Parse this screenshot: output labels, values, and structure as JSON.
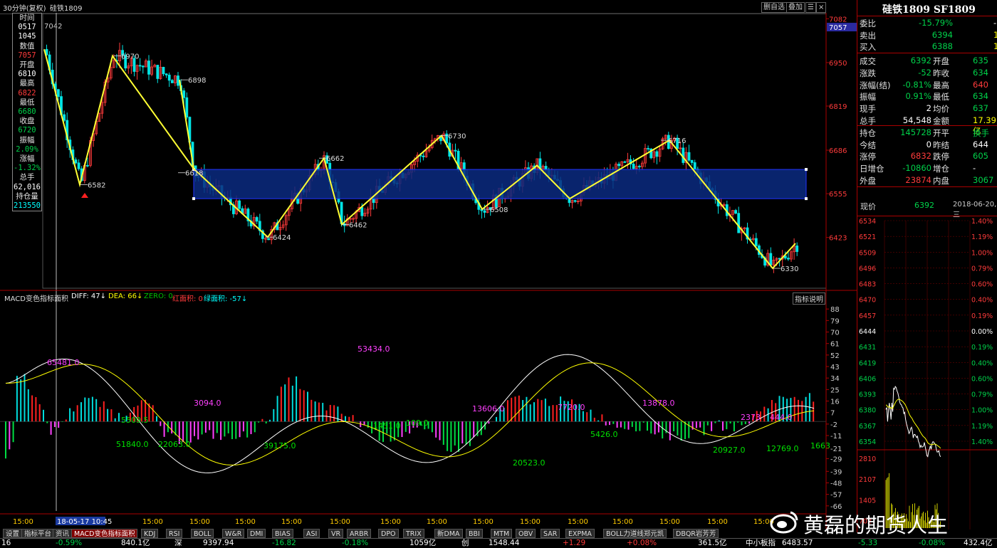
{
  "topbar": {
    "period": "30分钟(复权)",
    "symbol": "硅铁1809",
    "btn_fav": "删自选",
    "btn_overlay": "叠加",
    "btn_more": "☰",
    "btn_close": "×"
  },
  "infobox": [
    {
      "t": "时间",
      "c": "lbl"
    },
    {
      "t": "0517",
      "c": "white"
    },
    {
      "t": "1045",
      "c": "white"
    },
    {
      "t": "数值",
      "c": "lbl"
    },
    {
      "t": "7057",
      "c": "red"
    },
    {
      "t": "开盘",
      "c": "lbl"
    },
    {
      "t": "6810",
      "c": "white"
    },
    {
      "t": "最高",
      "c": "lbl"
    },
    {
      "t": "6822",
      "c": "red"
    },
    {
      "t": "最低",
      "c": "lbl"
    },
    {
      "t": "6680",
      "c": "green"
    },
    {
      "t": "收盘",
      "c": "lbl"
    },
    {
      "t": "6720",
      "c": "green"
    },
    {
      "t": "振幅",
      "c": "lbl"
    },
    {
      "t": "2.09%",
      "c": "green"
    },
    {
      "t": "涨幅",
      "c": "lbl"
    },
    {
      "t": "-1.32%",
      "c": "green"
    },
    {
      "t": "总手",
      "c": "lbl"
    },
    {
      "t": "62,016",
      "c": "white"
    },
    {
      "t": "持仓量",
      "c": "lbl"
    },
    {
      "t": "213550",
      "c": "cyan"
    }
  ],
  "price_axis": {
    "ticks": [
      "7082",
      "6950",
      "6819",
      "6686",
      "6555",
      "6423"
    ],
    "current": "7057",
    "corner_value": "7042"
  },
  "pivots": [
    {
      "label": "6970",
      "v": 6970
    },
    {
      "label": "6582",
      "v": 6582
    },
    {
      "label": "6898",
      "v": 6898
    },
    {
      "label": "6618",
      "v": 6618
    },
    {
      "label": "6424",
      "v": 6424
    },
    {
      "label": "6662",
      "v": 6662
    },
    {
      "label": "6462",
      "v": 6462
    },
    {
      "label": "6730",
      "v": 6730
    },
    {
      "label": "6508",
      "v": 6508
    },
    {
      "label": "6716",
      "v": 6716
    },
    {
      "label": "6330",
      "v": 6330
    }
  ],
  "macd_header": {
    "name": "MACD变色指标面积",
    "diff": "DIFF: 47↓",
    "dea": "DEA: 66↓",
    "zero": "ZERO: 0",
    "red_area": "红面积: 0",
    "green_area": "绿面积: -57↓",
    "help": "指标说明"
  },
  "macd_axis": [
    "88",
    "79",
    "70",
    "61",
    "52",
    "43",
    "34",
    "25",
    "16",
    "7",
    "-2",
    "-11",
    "-21",
    "-29",
    "-39",
    "-48",
    "-57",
    "-66"
  ],
  "macd_labels": [
    "65481.0",
    "5509.5",
    "51840.0",
    "22063.0",
    "3094.0",
    "39175.0",
    "1451.0",
    "53434.0",
    "109.0",
    "13606.0",
    "20523.0",
    "7720.0",
    "5426.0",
    "13878.0",
    "20927.0",
    "2373",
    "12769.0",
    "444.0",
    "1663"
  ],
  "time_labels": [
    "15:00",
    "18-05-17 10:45",
    "15:00",
    "15:00",
    "15:00",
    "15:00",
    "15:00",
    "15:00",
    "15:00",
    "15:00",
    "15:00",
    "15:00",
    "15:00",
    "15:00",
    "15:00",
    "15:00"
  ],
  "right": {
    "title": "硅铁1809 SF1809",
    "rows": [
      {
        "a": "委比",
        "b": "-15.79%",
        "bc": "green",
        "c": "",
        "d": "-1",
        "dc": "white"
      },
      {
        "a": "卖出",
        "b": "6394",
        "bc": "green",
        "c": "",
        "d": "1",
        "dc": "yellow"
      },
      {
        "a": "买入",
        "b": "6388",
        "bc": "green",
        "c": "",
        "d": "1",
        "dc": "yellow"
      },
      {
        "a": "成交",
        "b": "6392",
        "bc": "green",
        "c": "开盘",
        "d": "635",
        "dc": "green"
      },
      {
        "a": "涨跌",
        "b": "-52",
        "bc": "green",
        "c": "昨收",
        "d": "634",
        "dc": "green"
      },
      {
        "a": "涨幅(结)",
        "b": "-0.81%",
        "bc": "green",
        "c": "最高",
        "d": "640",
        "dc": "red"
      },
      {
        "a": "振幅",
        "b": "0.91%",
        "bc": "green",
        "c": "最低",
        "d": "634",
        "dc": "green"
      },
      {
        "a": "现手",
        "b": "2",
        "bc": "white",
        "c": "均价",
        "d": "637",
        "dc": "green"
      },
      {
        "a": "总手",
        "b": "54,548",
        "bc": "white",
        "c": "金额",
        "d": "17.39亿",
        "dc": "yellow"
      },
      {
        "a": "持仓",
        "b": "145728",
        "bc": "green",
        "c": "开平",
        "d": "换手",
        "dc": "green"
      },
      {
        "a": "今结",
        "b": "0",
        "bc": "white",
        "c": "昨结",
        "d": "644",
        "dc": "white"
      },
      {
        "a": "涨停",
        "b": "6832",
        "bc": "red",
        "c": "跌停",
        "d": "605",
        "dc": "green"
      },
      {
        "a": "日增仓",
        "b": "-10860",
        "bc": "green",
        "c": "增仓",
        "d": "-",
        "dc": "white"
      },
      {
        "a": "外盘",
        "b": "23874",
        "bc": "red",
        "c": "内盘",
        "d": "3067",
        "dc": "green"
      }
    ],
    "current_label": "现价",
    "current_price": "6392",
    "date": "2018-06-20,三",
    "mini_prices": [
      "6534",
      "6521",
      "6509",
      "6496",
      "6483",
      "6470",
      "6457",
      "6444",
      "6431",
      "6419",
      "6406",
      "6393",
      "6380",
      "6367",
      "6354"
    ],
    "mini_pcts": [
      "1.40%",
      "1.19%",
      "1.00%",
      "0.79%",
      "0.60%",
      "0.40%",
      "0.19%",
      "0.00%",
      "0.19%",
      "0.40%",
      "0.60%",
      "0.79%",
      "1.00%",
      "1.19%",
      "1.40%"
    ],
    "vol_ticks": [
      "2810",
      "2107",
      "1405",
      "702"
    ]
  },
  "tabs": [
    "设置",
    "指标平台",
    "资讯",
    "MACD变色指标面积",
    "KDJ",
    "RSI",
    "BOLL",
    "W&R",
    "DMI",
    "BIAS",
    "ASI",
    "VR",
    "ARBR",
    "DPO",
    "TRIX",
    "新DMA",
    "BBI",
    "MTM",
    "OBV",
    "SAR",
    "EXPMA",
    "BOLL力道线郑元凯",
    "DBQR岩芳芳"
  ],
  "status": [
    {
      "t": "16",
      "c": "white"
    },
    {
      "t": "-0.59%",
      "c": "green"
    },
    {
      "t": "840.1亿",
      "c": "white"
    },
    {
      "t": "深",
      "c": "white"
    },
    {
      "t": "9397.94",
      "c": "white"
    },
    {
      "t": "-16.82",
      "c": "green"
    },
    {
      "t": "-0.18%",
      "c": "green"
    },
    {
      "t": "1059亿",
      "c": "white"
    },
    {
      "t": "创",
      "c": "white"
    },
    {
      "t": "1548.44",
      "c": "white"
    },
    {
      "t": "+1.29",
      "c": "red"
    },
    {
      "t": "+0.08%",
      "c": "red"
    },
    {
      "t": "361.5亿",
      "c": "white"
    },
    {
      "t": "中小板指",
      "c": "white"
    },
    {
      "t": "6483.57",
      "c": "white"
    },
    {
      "t": "-5.33",
      "c": "green"
    },
    {
      "t": "-0.08%",
      "c": "green"
    },
    {
      "t": "432.4亿",
      "c": "white"
    }
  ],
  "watermark": "黄磊的期货人生",
  "colors": {
    "up": "#ff3b3b",
    "down": "#00e5e5",
    "zigzag": "#ffff33",
    "box": "#0a2a80"
  }
}
